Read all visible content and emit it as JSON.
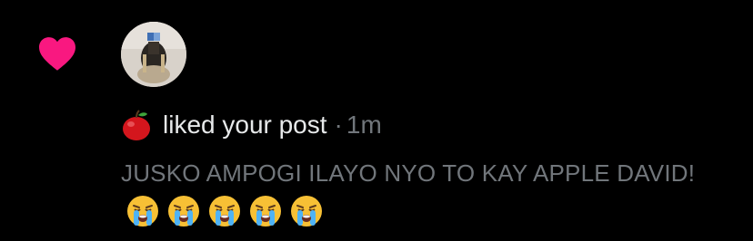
{
  "notification": {
    "action": "liked your post",
    "separator": "·",
    "time": "1m",
    "post_text": "JUSKO AMPOGI ILAYO NYO TO KAY APPLE DAVID!",
    "emoji_count": 5,
    "icons": {
      "like": "heart-icon",
      "user_badge": "apple-icon",
      "emoji": "loudly-crying-face-icon"
    },
    "colors": {
      "heart": "#f91880",
      "text_primary": "#e7e9ea",
      "text_secondary": "#71767b",
      "background": "#000000"
    }
  }
}
